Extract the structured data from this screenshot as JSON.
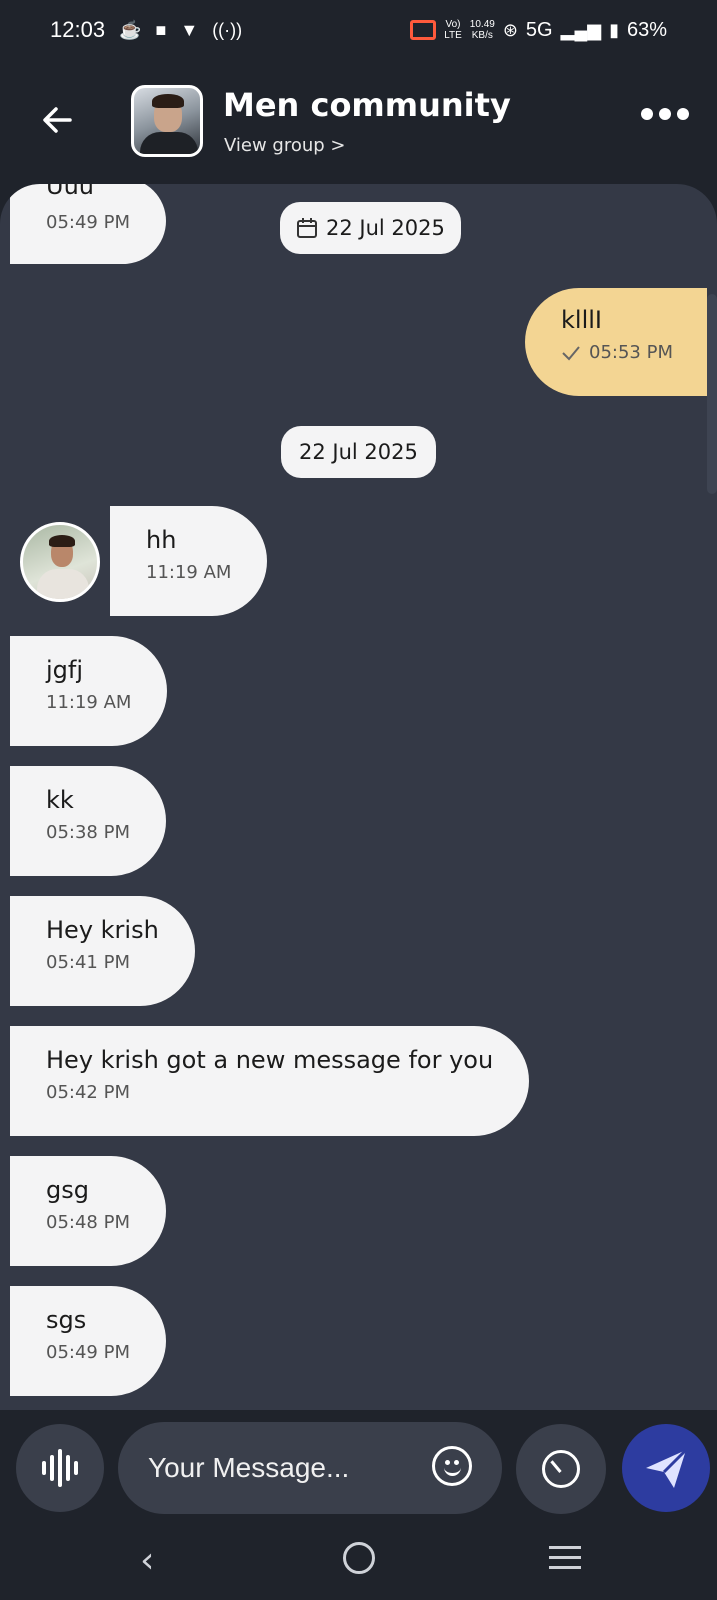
{
  "status_bar": {
    "time": "12:03",
    "net_speed": "10.49",
    "net_unit": "KB/s",
    "lte_top": "Vo)",
    "lte_bottom": "LTE",
    "network": "5G",
    "battery": "63%"
  },
  "header": {
    "title": "Men community",
    "subtitle": "View group >"
  },
  "date_chips": [
    {
      "label": "22 Jul 2025"
    },
    {
      "label": "22 Jul 2025"
    }
  ],
  "messages": [
    {
      "text": "Uuu",
      "time": "05:49 PM"
    },
    {
      "text": "klllI",
      "time": "05:53 PM",
      "outgoing": true
    },
    {
      "text": "hh",
      "time": "11:19 AM"
    },
    {
      "text": "jgfj",
      "time": "11:19 AM"
    },
    {
      "text": "kk",
      "time": "05:38 PM"
    },
    {
      "text": "Hey krish",
      "time": "05:41 PM"
    },
    {
      "text": "Hey krish got a new message for you",
      "time": "05:42 PM"
    },
    {
      "text": "gsg",
      "time": "05:48 PM"
    },
    {
      "text": "sgs",
      "time": "05:49 PM"
    }
  ],
  "input": {
    "placeholder": "Your Message..."
  },
  "icons": {
    "back": "arrow-left-icon",
    "more": "more-horizontal-icon",
    "calendar": "calendar-icon",
    "check": "check-icon",
    "voice": "waveform-icon",
    "emoji": "smiley-icon",
    "timer": "timer-icon",
    "send": "send-icon"
  },
  "colors": {
    "background": "#1f232b",
    "chat_panel": "#343946",
    "incoming_bubble": "#f4f4f5",
    "outgoing_bubble": "#f3d593",
    "send_button": "#2d3ca0"
  }
}
